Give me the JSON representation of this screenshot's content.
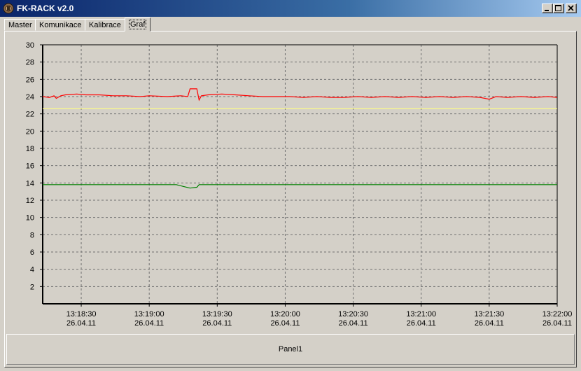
{
  "window": {
    "title": "FK-RACK  v2.0",
    "controls": [
      "minimize",
      "maximize",
      "close"
    ]
  },
  "tabs": [
    {
      "label": "Master",
      "active": false
    },
    {
      "label": "Komunikace",
      "active": false
    },
    {
      "label": "Kalibrace",
      "active": false
    },
    {
      "label": "Graf",
      "active": true
    }
  ],
  "panel": {
    "label": "Panel1"
  },
  "colors": {
    "series_red": "#ff0000",
    "series_yellow": "#ffff80",
    "series_green": "#008000",
    "grid": "#707070"
  },
  "chart_data": {
    "type": "line",
    "title": "",
    "xlabel": "",
    "ylabel": "",
    "ylim": [
      0,
      30
    ],
    "yticks": [
      2,
      4,
      6,
      8,
      10,
      12,
      14,
      16,
      18,
      20,
      22,
      24,
      26,
      28,
      30
    ],
    "xlim": [
      "13:18:13",
      "13:22:00"
    ],
    "xticks": [
      {
        "time": "13:18:30",
        "date": "26.04.11"
      },
      {
        "time": "13:19:00",
        "date": "26.04.11"
      },
      {
        "time": "13:19:30",
        "date": "26.04.11"
      },
      {
        "time": "13:20:00",
        "date": "26.04.11"
      },
      {
        "time": "13:20:30",
        "date": "26.04.11"
      },
      {
        "time": "13:21:00",
        "date": "26.04.11"
      },
      {
        "time": "13:21:30",
        "date": "26.04.11"
      },
      {
        "time": "13:22:00",
        "date": "26.04.11"
      }
    ],
    "grid": true,
    "legend": "none",
    "series": [
      {
        "color": "#ff0000",
        "points": [
          [
            "13:18:13",
            24.0
          ],
          [
            "13:18:16",
            23.9
          ],
          [
            "13:18:18",
            24.1
          ],
          [
            "13:18:19",
            23.8
          ],
          [
            "13:18:21",
            24.1
          ],
          [
            "13:18:23",
            24.2
          ],
          [
            "13:18:28",
            24.3
          ],
          [
            "13:18:32",
            24.2
          ],
          [
            "13:18:38",
            24.2
          ],
          [
            "13:18:44",
            24.1
          ],
          [
            "13:18:50",
            24.1
          ],
          [
            "13:18:56",
            24.0
          ],
          [
            "13:19:00",
            24.1
          ],
          [
            "13:19:08",
            24.0
          ],
          [
            "13:19:14",
            24.1
          ],
          [
            "13:19:17",
            24.0
          ],
          [
            "13:19:18",
            24.9
          ],
          [
            "13:19:20",
            24.9
          ],
          [
            "13:19:21",
            24.9
          ],
          [
            "13:19:22",
            23.6
          ],
          [
            "13:19:23",
            24.1
          ],
          [
            "13:19:26",
            24.2
          ],
          [
            "13:19:32",
            24.3
          ],
          [
            "13:19:38",
            24.2
          ],
          [
            "13:19:44",
            24.1
          ],
          [
            "13:19:50",
            24.0
          ],
          [
            "13:19:56",
            24.0
          ],
          [
            "13:20:02",
            24.0
          ],
          [
            "13:20:08",
            23.9
          ],
          [
            "13:20:14",
            24.0
          ],
          [
            "13:20:20",
            23.9
          ],
          [
            "13:20:26",
            23.9
          ],
          [
            "13:20:32",
            24.0
          ],
          [
            "13:20:38",
            23.9
          ],
          [
            "13:20:44",
            24.0
          ],
          [
            "13:20:50",
            23.9
          ],
          [
            "13:20:56",
            24.0
          ],
          [
            "13:21:02",
            23.9
          ],
          [
            "13:21:08",
            24.0
          ],
          [
            "13:21:14",
            23.9
          ],
          [
            "13:21:20",
            24.0
          ],
          [
            "13:21:26",
            23.9
          ],
          [
            "13:21:30",
            23.7
          ],
          [
            "13:21:33",
            24.0
          ],
          [
            "13:21:38",
            23.9
          ],
          [
            "13:21:44",
            24.0
          ],
          [
            "13:21:50",
            23.9
          ],
          [
            "13:21:56",
            24.0
          ],
          [
            "13:22:00",
            23.9
          ]
        ]
      },
      {
        "color": "#ffff80",
        "points": [
          [
            "13:18:13",
            22.6
          ],
          [
            "13:22:00",
            22.6
          ]
        ]
      },
      {
        "color": "#008000",
        "points": [
          [
            "13:18:13",
            13.8
          ],
          [
            "13:19:12",
            13.8
          ],
          [
            "13:19:15",
            13.6
          ],
          [
            "13:19:18",
            13.4
          ],
          [
            "13:19:21",
            13.5
          ],
          [
            "13:19:22",
            13.8
          ],
          [
            "13:22:00",
            13.8
          ]
        ]
      }
    ]
  }
}
